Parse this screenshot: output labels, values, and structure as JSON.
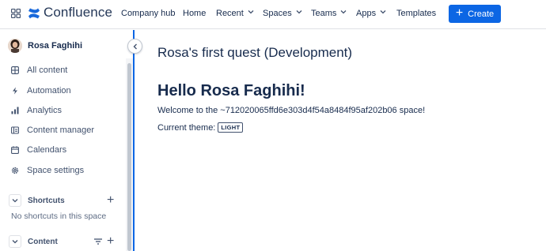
{
  "app": {
    "name": "Confluence"
  },
  "nav": {
    "items": [
      {
        "label": "Company hub",
        "dropdown": false
      },
      {
        "label": "Home",
        "dropdown": false
      },
      {
        "label": "Recent",
        "dropdown": true
      },
      {
        "label": "Spaces",
        "dropdown": true
      },
      {
        "label": "Teams",
        "dropdown": true
      },
      {
        "label": "Apps",
        "dropdown": true
      },
      {
        "label": "Templates",
        "dropdown": false
      }
    ],
    "create_label": "Create"
  },
  "sidebar": {
    "user_name": "Rosa Faghihi",
    "items": [
      {
        "label": "All content",
        "icon": "all-content-icon"
      },
      {
        "label": "Automation",
        "icon": "lightning-icon"
      },
      {
        "label": "Analytics",
        "icon": "chart-icon"
      },
      {
        "label": "Content manager",
        "icon": "content-manager-icon"
      },
      {
        "label": "Calendars",
        "icon": "calendar-icon"
      },
      {
        "label": "Space settings",
        "icon": "gear-icon"
      }
    ],
    "shortcuts": {
      "label": "Shortcuts",
      "empty": "No shortcuts in this space"
    },
    "content": {
      "label": "Content"
    }
  },
  "main": {
    "page_title": "Rosa's first quest (Development)",
    "heading": "Hello Rosa Faghihi!",
    "welcome": "Welcome to the ~712020065ffd6e303d4f54a8484f95af202b06 space!",
    "theme_label": "Current theme:",
    "theme_value": "LIGHT"
  },
  "colors": {
    "accent": "#0c66e4",
    "text": "#172b4d",
    "subtle": "#42526e"
  }
}
